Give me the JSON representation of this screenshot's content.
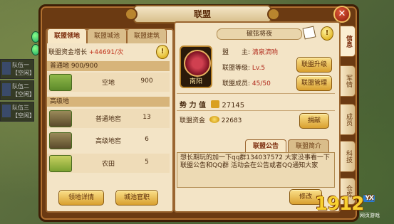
{
  "window": {
    "title": "联盟",
    "close_label": "✕"
  },
  "party": [
    {
      "line1": "队伍一",
      "line2": "【空闲】"
    },
    {
      "line1": "队伍二",
      "line2": "【空闲】"
    },
    {
      "line1": "队伍三",
      "line2": "【空闲】"
    }
  ],
  "left_tabs": [
    "联盟领地",
    "联盟城池",
    "联盟建筑"
  ],
  "fund": {
    "label": "联盟资金增长 ",
    "value": "+44691/次"
  },
  "sections": {
    "normal": "普通地 900/900",
    "advanced": "高级地"
  },
  "plots": [
    {
      "name": "空地",
      "count": "900"
    },
    {
      "name": "普通地窖",
      "count": "13"
    },
    {
      "name": "高级地窖",
      "count": "6"
    },
    {
      "name": "农田",
      "count": "5"
    }
  ],
  "buttons": {
    "land_detail": "领地详情",
    "city_official": "城池官职",
    "upgrade": "联盟升级",
    "manage": "联盟管理",
    "donate": "捐献",
    "edit": "修改"
  },
  "alliance": {
    "motto": "破弦将夜",
    "emblem_label": "南阳",
    "leader_label": "盟　　主:",
    "leader": "清泉流响",
    "level_label": "联盟等级:",
    "level": "Lv.5",
    "members_label": "联盟成员:",
    "members": "45/50",
    "power_label": "势 力 值",
    "power": "27145",
    "fund_label": "联盟资金",
    "fund": "22683"
  },
  "bottom_tabs": [
    "联盟公告",
    "联盟简介"
  ],
  "notice": "想长期玩的加一下qq群134037572 大家没事看一下联盟公告和QQ群 活动会在公告或者QQ通知大家",
  "side_tabs": [
    "信息",
    "军情",
    "成员",
    "科技",
    "仓库"
  ],
  "watermark": {
    "main": "1912",
    "sub": "YX",
    "site": "网页游戏"
  }
}
